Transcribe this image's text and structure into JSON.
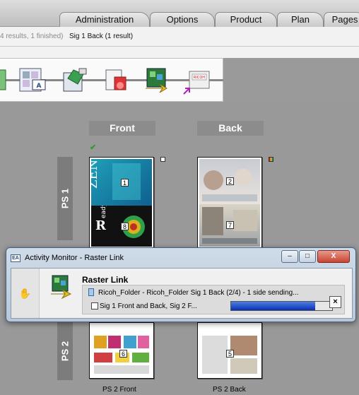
{
  "tabs": [
    "Administration",
    "Options",
    "Product",
    "Plan",
    "Pages"
  ],
  "status": {
    "results": "4 results, 1 finished)",
    "selection": "Sig 1 Back (1 result)"
  },
  "workflow": {
    "steps": [
      "import-step-icon",
      "imposition-step-icon",
      "preflight-step-icon",
      "proof-step-icon",
      "raster-link-step-icon",
      "ricoh-output-step-icon"
    ]
  },
  "columns": {
    "front": "Front",
    "back": "Back"
  },
  "sheets": {
    "ps1": {
      "label": "PS 1",
      "front_pages": [
        "1",
        "8"
      ],
      "back_pages": [
        "2",
        "7"
      ]
    },
    "ps2": {
      "label": "PS 2",
      "front_pages": [
        "6"
      ],
      "back_pages": [
        "5"
      ],
      "front_caption": "PS 2 Front",
      "back_caption": "PS 2 Back"
    }
  },
  "dialog": {
    "icon": "EA",
    "title": "Activity Monitor - Raster Link",
    "minimize": "–",
    "maximize": "□",
    "close": "X",
    "heading": "Raster Link",
    "job_line1": "Ricoh_Folder - Ricoh_Folder      Sig 1 Back (2/4) - 1 side      sending...",
    "job_line2": "Sig 1 Front and Back, Sig 2 F...",
    "progress": 0.83,
    "cancel": "×"
  },
  "colors": {
    "progress_fill": "#1a3fd0",
    "accent_check": "#2e9b2e"
  }
}
